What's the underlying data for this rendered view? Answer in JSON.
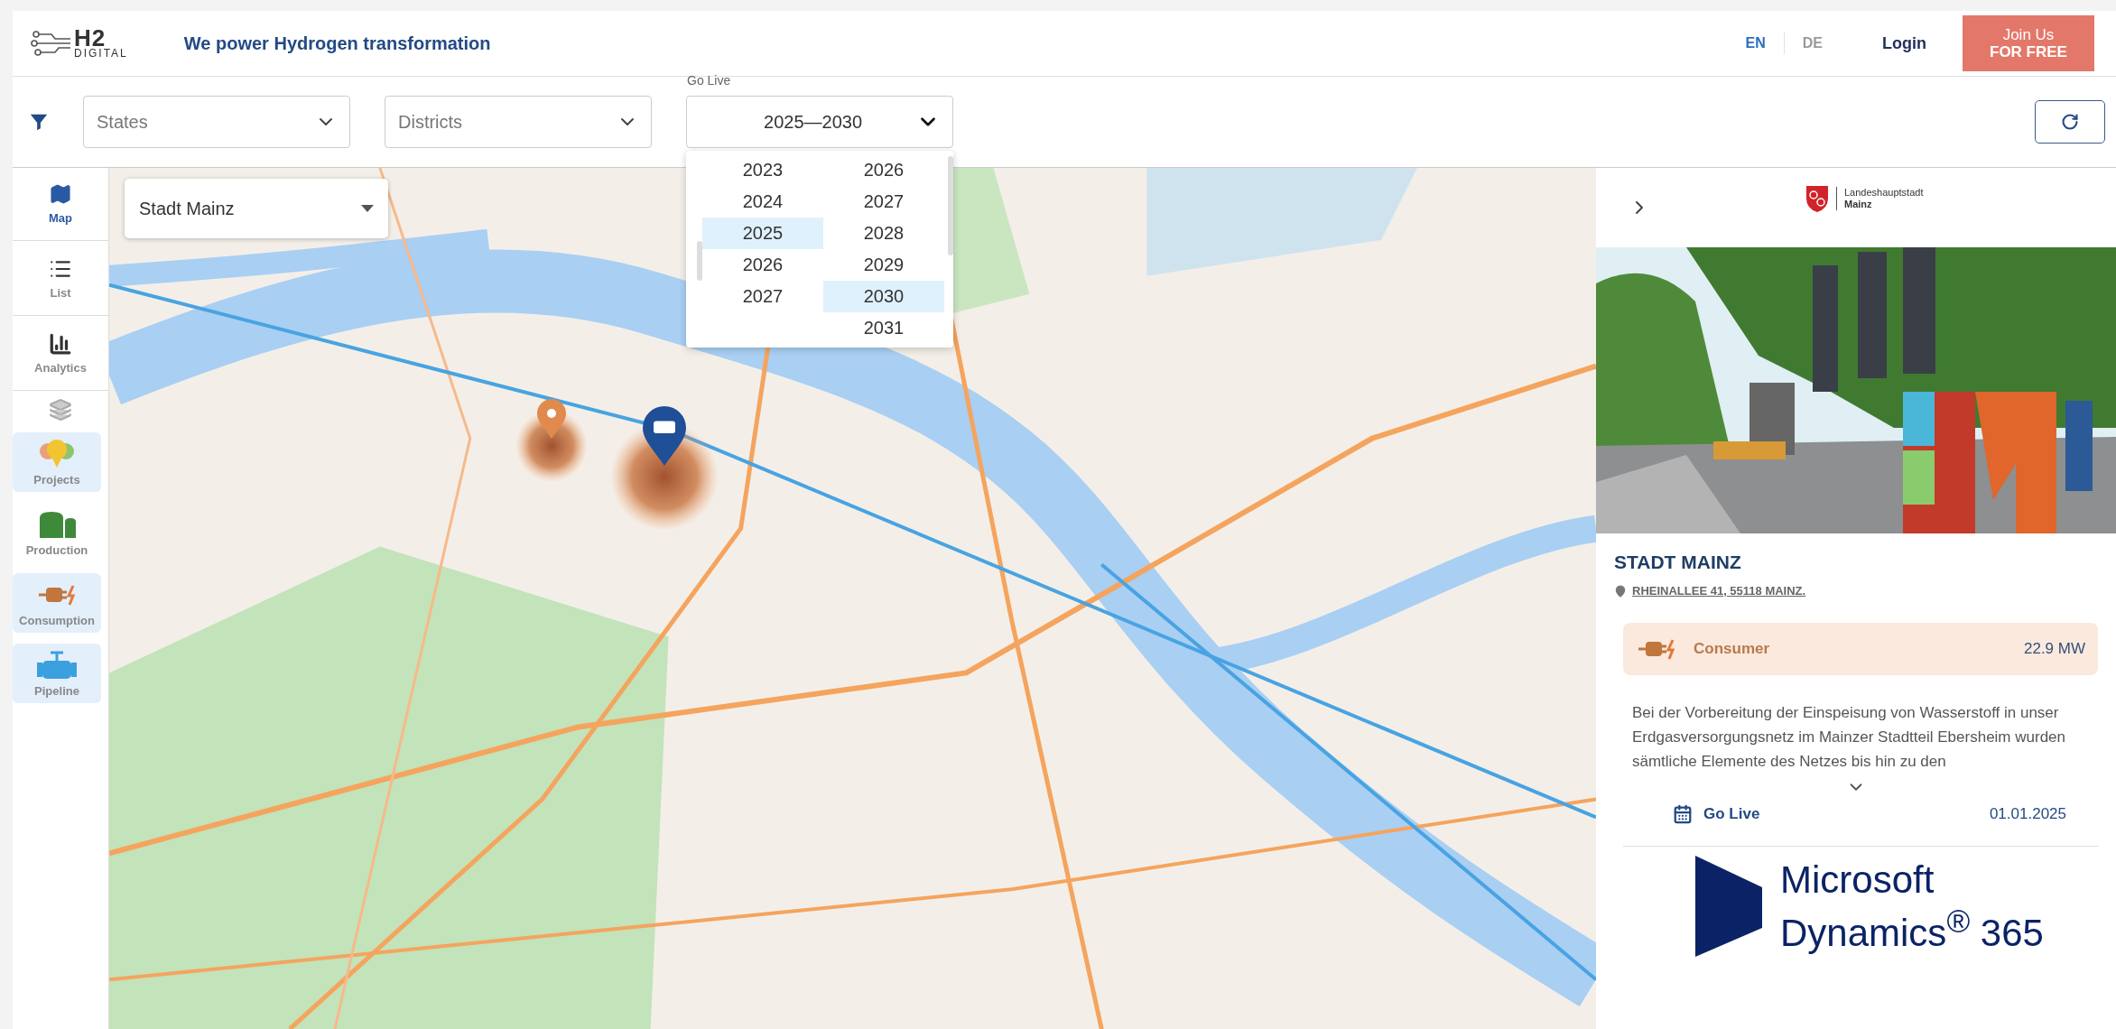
{
  "header": {
    "logo": {
      "mark": "H2",
      "wordmark": "DIGITAL"
    },
    "tagline": "We power Hydrogen transformation",
    "languages": [
      {
        "label": "EN",
        "selected": true
      },
      {
        "label": "DE",
        "selected": false
      }
    ],
    "login": "Login",
    "join_button": {
      "line_1": "Join Us",
      "line_2": "FOR FREE"
    }
  },
  "filters": {
    "states": {
      "placeholder": "States"
    },
    "districts": {
      "placeholder": "Districts"
    },
    "go_live": {
      "label": "Go Live",
      "value": "2025—2030",
      "expanded": true,
      "start_years": [
        {
          "label": "2023",
          "selected": false
        },
        {
          "label": "2024",
          "selected": false
        },
        {
          "label": "2025",
          "selected": true
        },
        {
          "label": "2026",
          "selected": false
        },
        {
          "label": "2027",
          "selected": false
        }
      ],
      "end_years": [
        {
          "label": "2026",
          "selected": false
        },
        {
          "label": "2027",
          "selected": false
        },
        {
          "label": "2028",
          "selected": false
        },
        {
          "label": "2029",
          "selected": false
        },
        {
          "label": "2030",
          "selected": true
        },
        {
          "label": "2031",
          "selected": false
        }
      ]
    }
  },
  "sidebar": {
    "views": [
      {
        "kind": "map",
        "label": "Map",
        "selected": true
      },
      {
        "kind": "list",
        "label": "List",
        "selected": false
      },
      {
        "kind": "analytics",
        "label": "Analytics",
        "selected": false
      }
    ],
    "layers": [
      {
        "kind": "projects",
        "label": "Projects",
        "on": true
      },
      {
        "kind": "production",
        "label": "Production",
        "on": false
      },
      {
        "kind": "consumption",
        "label": "Consumption",
        "on": true
      },
      {
        "kind": "pipeline",
        "label": "Pipeline",
        "on": true
      }
    ]
  },
  "map": {
    "place_select": {
      "value": "Stadt Mainz"
    },
    "markers": [
      {
        "kind": "production",
        "selected": false
      },
      {
        "kind": "consumption",
        "selected": true
      }
    ]
  },
  "detail_panel": {
    "city_logo": {
      "line_1": "Landeshauptstadt",
      "line_2": "Mainz"
    },
    "title": "STADT MAINZ",
    "address": "RHEINALLEE 41, 55118 MAINZ.",
    "category": {
      "label": "Consumer",
      "value": "22.9 MW"
    },
    "description": "Bei der Vorbereitung der Einspeisung von Wasserstoff in unser Erdgasversorgungsnetz im Mainzer Stadtteil Ebersheim wurden sämtliche Elemente des Netzes bis hin zu den",
    "go_live": {
      "label": "Go Live",
      "date": "01.01.2025"
    },
    "partner_logo": {
      "line_1": "Microsoft",
      "line_2": "Dynamics$^{®}$ 365"
    }
  }
}
